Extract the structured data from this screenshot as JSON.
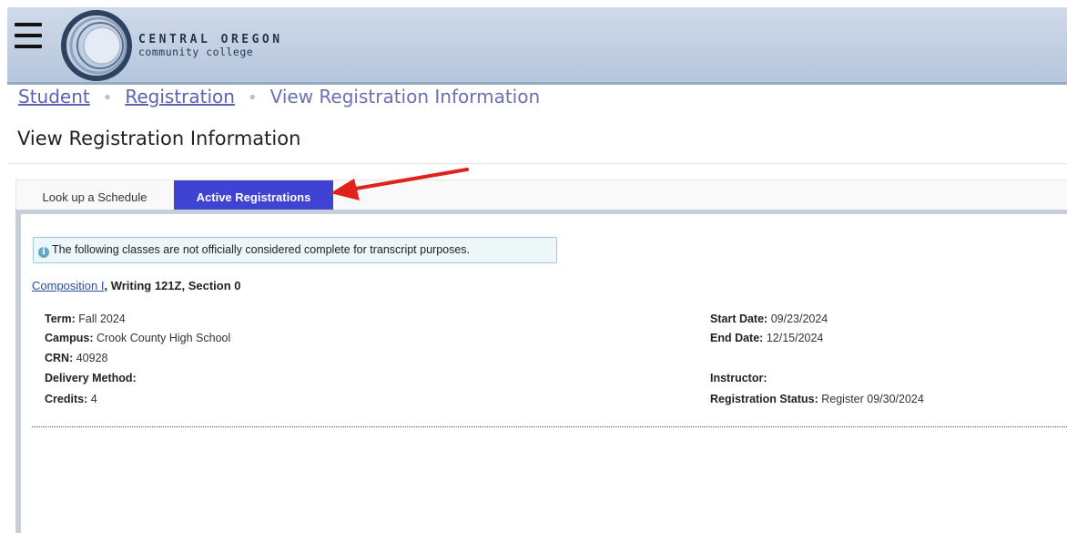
{
  "header": {
    "logo": {
      "line1": "CENTRAL OREGON",
      "line2": "community college"
    }
  },
  "breadcrumb": {
    "items": [
      "Student",
      "Registration",
      "View Registration Information"
    ]
  },
  "page": {
    "title": "View Registration Information"
  },
  "tabs": [
    {
      "label": "Look up a Schedule",
      "active": false
    },
    {
      "label": "Active Registrations",
      "active": true
    }
  ],
  "notice": {
    "text": "The following classes are not officially considered complete for transcript purposes."
  },
  "course": {
    "title": "Composition I",
    "subtitle": ", Writing 121Z, Section 0",
    "left": [
      {
        "label": "Term:",
        "value": "Fall 2024"
      },
      {
        "label": "Campus:",
        "value": "Crook County High School"
      },
      {
        "label": "CRN:",
        "value": "40928"
      },
      {
        "label": "Delivery Method:",
        "value": ""
      },
      {
        "label": "Credits:",
        "value": "4"
      }
    ],
    "right": [
      {
        "label": "Start Date:",
        "value": "09/23/2024"
      },
      {
        "label": "End Date:",
        "value": "12/15/2024"
      },
      {
        "label": "Instructor:",
        "value": ""
      },
      {
        "label": "Registration Status:",
        "value": "Register 09/30/2024"
      }
    ]
  },
  "colors": {
    "header_bg": "#c4d1e4",
    "active_tab": "#3e43d4",
    "link": "#5d63b0",
    "annotation_arrow": "#e0221b"
  }
}
